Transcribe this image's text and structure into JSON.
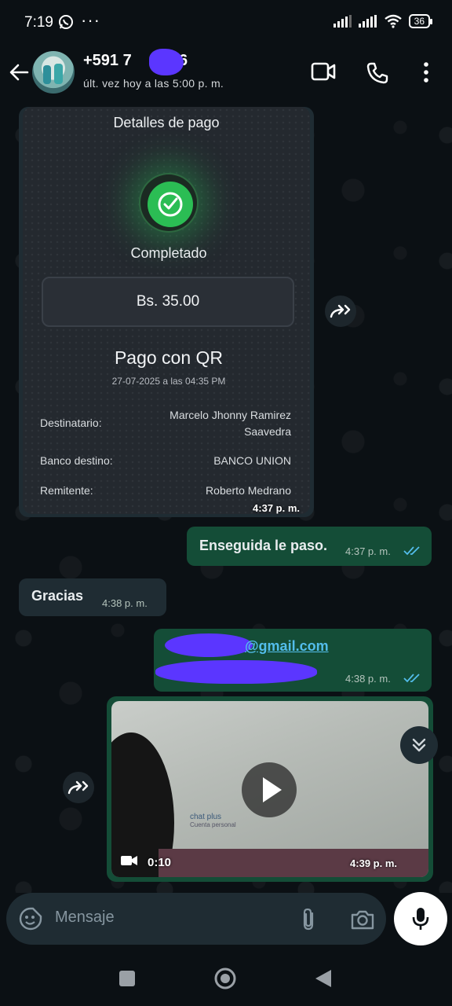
{
  "status_bar": {
    "time": "7:19",
    "dots": "···",
    "battery": "36"
  },
  "header": {
    "contact_name": "+591 7",
    "contact_name_end": "986",
    "last_seen": "últ. vez hoy a las 5:00 p. m."
  },
  "receipt": {
    "title": "Detalles de pago",
    "status": "Completado",
    "amount": "Bs. 35.00",
    "payment_type": "Pago con QR",
    "date": "27-07-2025 a las 04:35 PM",
    "rows": [
      {
        "label": "Destinatario:",
        "value_line1": "Marcelo Jhonny Ramirez",
        "value_line2": "Saavedra"
      },
      {
        "label": "Banco destino:",
        "value_line1": "BANCO UNION"
      },
      {
        "label": "Remitente:",
        "value_line1": "Roberto Medrano"
      }
    ],
    "time": "4:37 p. m."
  },
  "messages": [
    {
      "direction": "out",
      "text": "Enseguida le paso.",
      "time": "4:37 p. m.",
      "status": "read"
    },
    {
      "direction": "in",
      "text": "Gracias",
      "time": "4:38 p. m."
    },
    {
      "direction": "out",
      "text": "@gmail.com",
      "time": "4:38 p. m.",
      "status": "read"
    }
  ],
  "video": {
    "duration": "0:10",
    "time": "4:39 p. m.",
    "preview_text": "chat plus",
    "preview_sub": "Cuenta personal"
  },
  "input": {
    "placeholder": "Mensaje"
  },
  "colors": {
    "background": "#0b1014",
    "incoming_bubble": "#1f2c33",
    "outgoing_bubble": "#144d37",
    "read_ticks": "#53bdeb",
    "success_green": "#2bbd54",
    "redaction": "#5b36ff"
  },
  "icons": [
    "back-arrow-icon",
    "video-call-icon",
    "phone-icon",
    "more-vert-icon",
    "forward-icon",
    "check-icon",
    "play-icon",
    "camera-video-icon",
    "chevron-double-down-icon",
    "sticker-icon",
    "attach-icon",
    "camera-icon",
    "mic-icon",
    "nav-recents-icon",
    "nav-home-icon",
    "nav-back-icon"
  ]
}
